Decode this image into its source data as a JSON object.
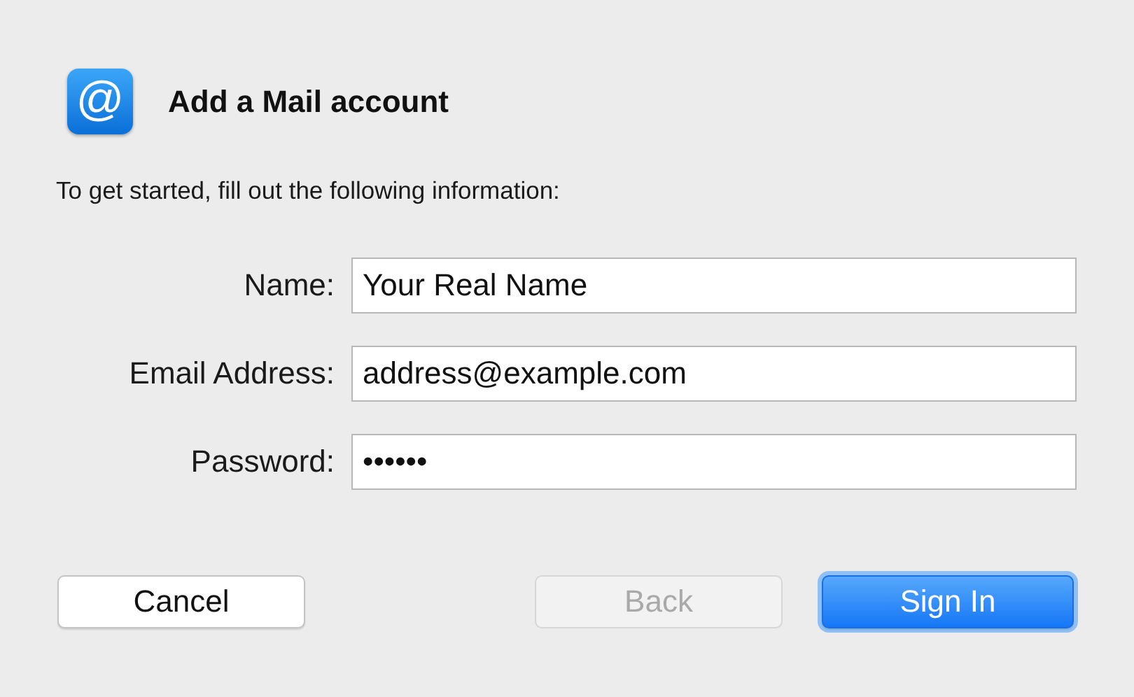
{
  "dialog": {
    "icon_glyph": "@",
    "title": "Add a Mail account",
    "intro": "To get started, fill out the following information:"
  },
  "fields": [
    {
      "label": "Name:",
      "value": "Your Real Name"
    },
    {
      "label": "Email Address:",
      "value": "address@example.com"
    },
    {
      "label": "Password:",
      "value": "••••••"
    }
  ],
  "buttons": [
    {
      "label": "Cancel",
      "kind": "normal",
      "disabled": false
    },
    {
      "label": "Back",
      "kind": "normal",
      "disabled": true
    },
    {
      "label": "Sign In",
      "kind": "default",
      "disabled": false
    }
  ]
}
